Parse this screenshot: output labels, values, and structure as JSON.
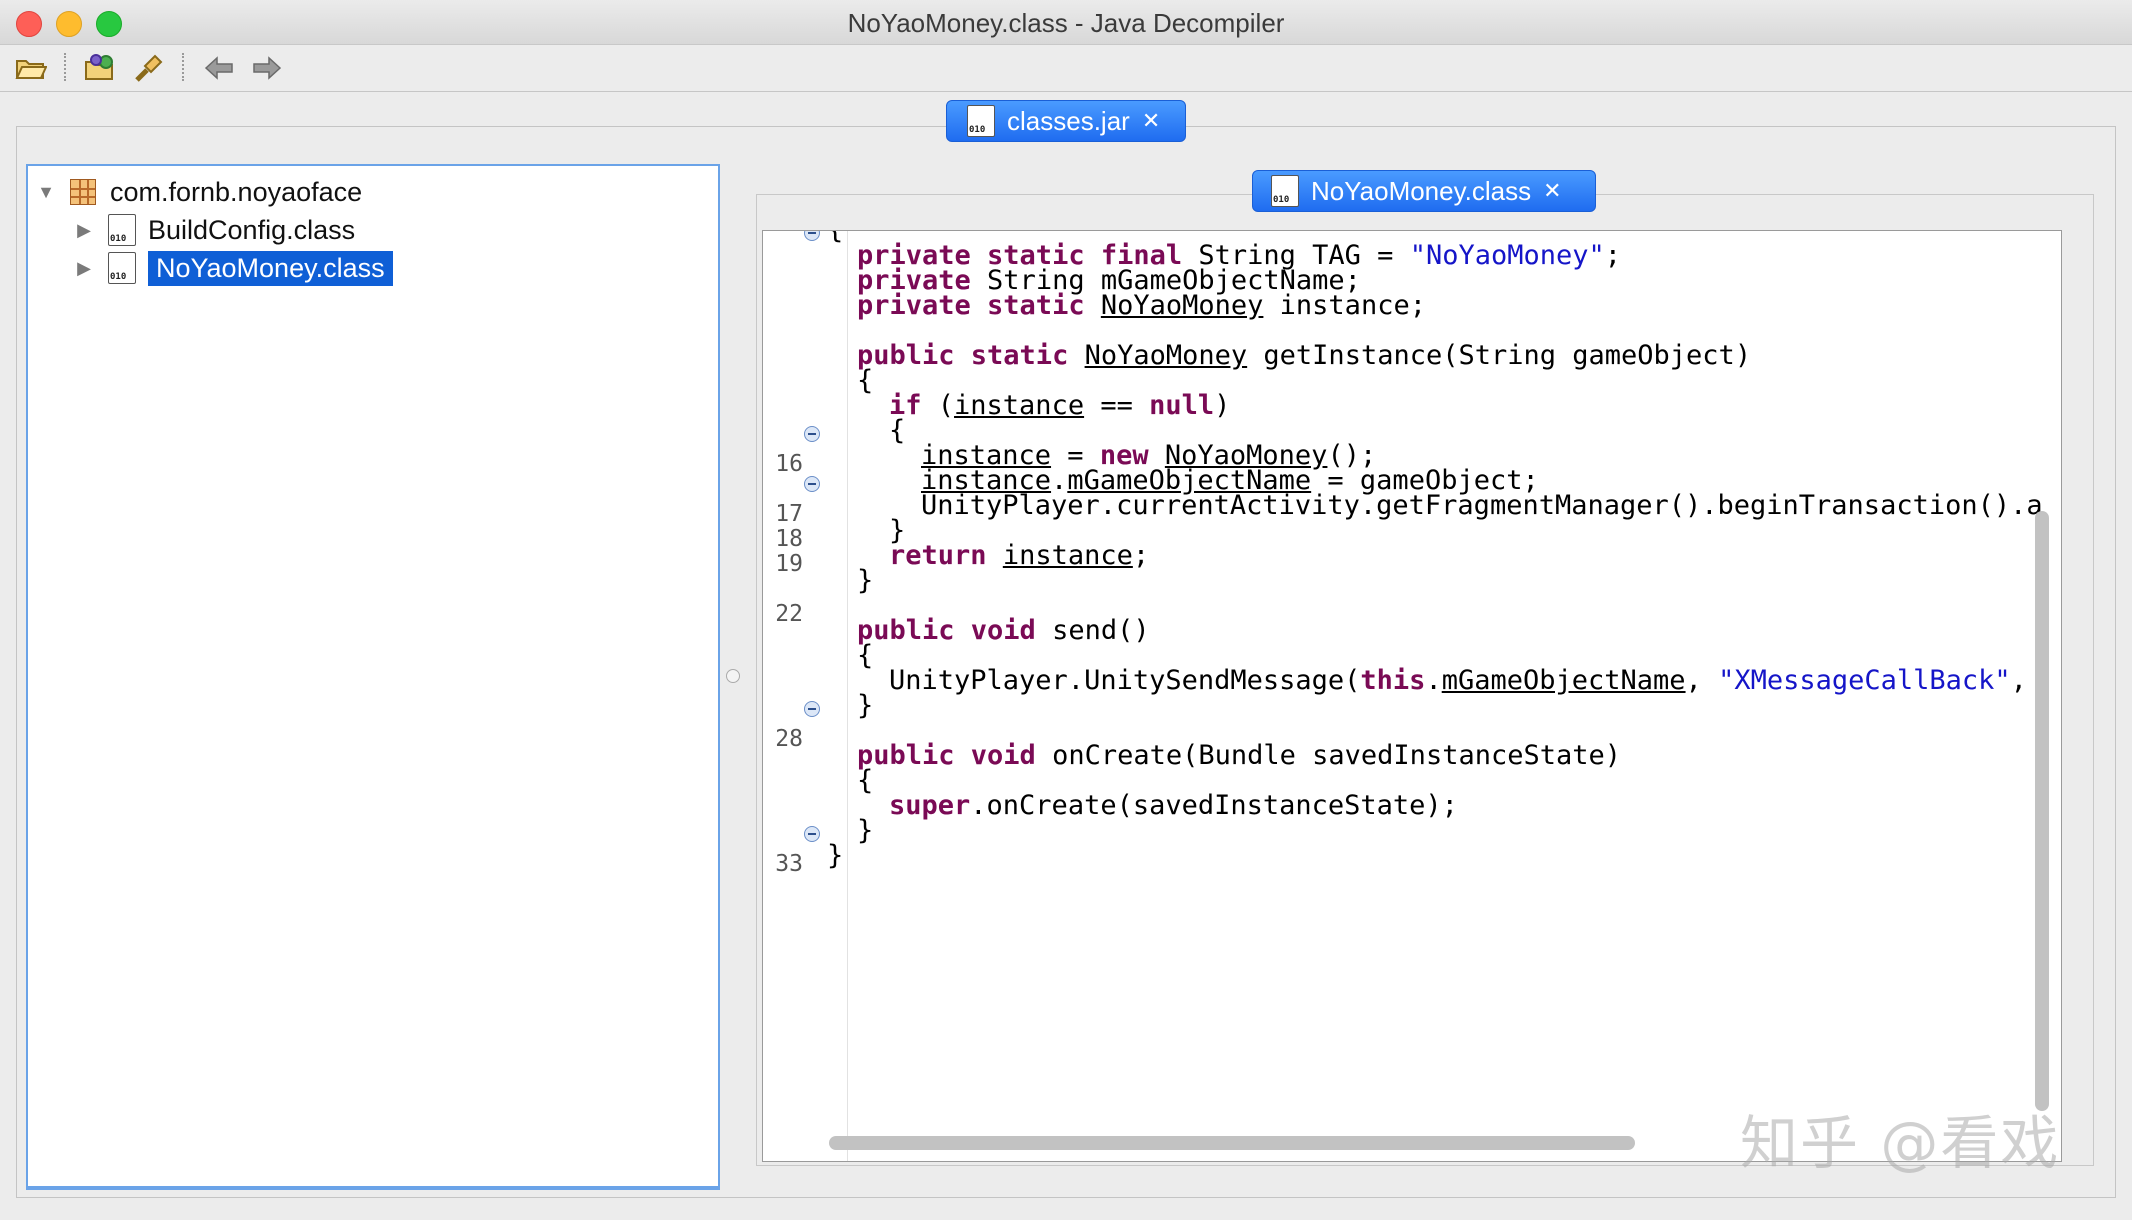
{
  "window": {
    "title": "NoYaoMoney.class - Java Decompiler"
  },
  "toolbar": {
    "icons": [
      "open-file-icon",
      "open-type-icon",
      "search-icon",
      "back-arrow-icon",
      "forward-arrow-icon"
    ]
  },
  "tabs": {
    "jar": "classes.jar",
    "class": "NoYaoMoney.class"
  },
  "tree": {
    "package": "com.fornb.noyaoface",
    "items": [
      "BuildConfig.class",
      "NoYaoMoney.class"
    ]
  },
  "code": {
    "line_numbers": [
      "16",
      "17",
      "18",
      "19",
      "22",
      "28",
      "33"
    ]
  },
  "watermark": "知乎 @看戏"
}
